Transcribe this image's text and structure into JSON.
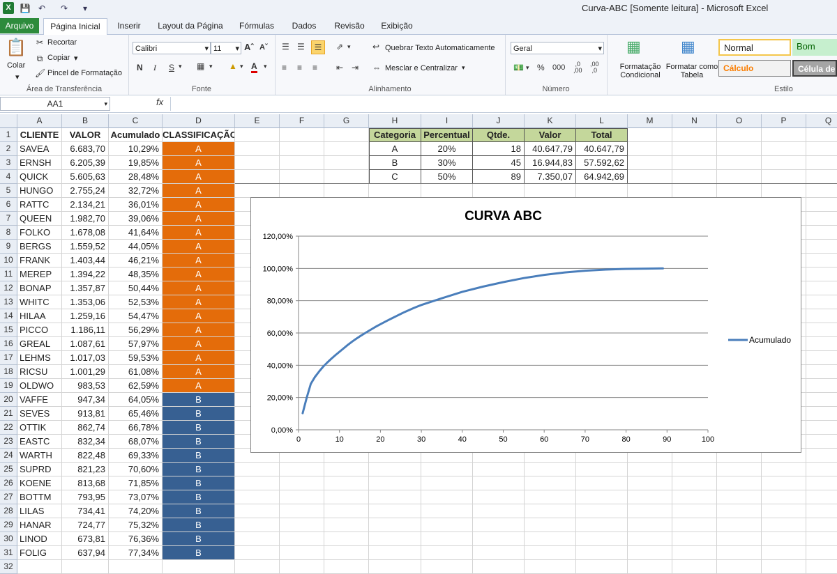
{
  "window": {
    "app_logo": "excel-icon",
    "title": "Curva-ABC  [Somente leitura]  -  Microsoft Excel"
  },
  "qat": {
    "save_icon": "save-icon",
    "undo_icon": "undo-icon",
    "redo_icon": "redo-icon"
  },
  "tabs": {
    "file": "Arquivo",
    "items": [
      "Página Inicial",
      "Inserir",
      "Layout da Página",
      "Fórmulas",
      "Dados",
      "Revisão",
      "Exibição"
    ]
  },
  "ribbon": {
    "clipboard": {
      "paste": "Colar",
      "cut": "Recortar",
      "copy": "Copiar",
      "format_painter": "Pincel de Formatação",
      "label": "Área de Transferência"
    },
    "font": {
      "name": "Calibri",
      "size": "11",
      "bold": "N",
      "italic": "I",
      "underline": "S",
      "label": "Fonte"
    },
    "alignment": {
      "wrap": "Quebrar Texto Automaticamente",
      "merge": "Mesclar e Centralizar",
      "label": "Alinhamento"
    },
    "number": {
      "format": "Geral",
      "percent": "%",
      "thousands": "000",
      "label": "Número"
    },
    "styles": {
      "conditional": "Formatação Condicional",
      "as_table": "Formatar como Tabela",
      "normal": "Normal",
      "good": "Bom",
      "calc": "Cálculo",
      "check_cell": "Célula de",
      "label": "Estilo"
    }
  },
  "formula_bar": {
    "name_box": "AA1",
    "fx": "fx",
    "formula": ""
  },
  "columns": [
    "A",
    "B",
    "C",
    "D",
    "E",
    "F",
    "G",
    "H",
    "I",
    "J",
    "K",
    "L",
    "M",
    "N",
    "O",
    "P",
    "Q"
  ],
  "sheet": {
    "headers": [
      "CLIENTE",
      "VALOR",
      "Acumulado",
      "CLASSIFICAÇÃO"
    ],
    "rows": [
      [
        "SAVEA",
        "6.683,70",
        "10,29%",
        "A"
      ],
      [
        "ERNSH",
        "6.205,39",
        "19,85%",
        "A"
      ],
      [
        "QUICK",
        "5.605,63",
        "28,48%",
        "A"
      ],
      [
        "HUNGO",
        "2.755,24",
        "32,72%",
        "A"
      ],
      [
        "RATTC",
        "2.134,21",
        "36,01%",
        "A"
      ],
      [
        "QUEEN",
        "1.982,70",
        "39,06%",
        "A"
      ],
      [
        "FOLKO",
        "1.678,08",
        "41,64%",
        "A"
      ],
      [
        "BERGS",
        "1.559,52",
        "44,05%",
        "A"
      ],
      [
        "FRANK",
        "1.403,44",
        "46,21%",
        "A"
      ],
      [
        "MEREP",
        "1.394,22",
        "48,35%",
        "A"
      ],
      [
        "BONAP",
        "1.357,87",
        "50,44%",
        "A"
      ],
      [
        "WHITC",
        "1.353,06",
        "52,53%",
        "A"
      ],
      [
        "HILAA",
        "1.259,16",
        "54,47%",
        "A"
      ],
      [
        "PICCO",
        "1.186,11",
        "56,29%",
        "A"
      ],
      [
        "GREAL",
        "1.087,61",
        "57,97%",
        "A"
      ],
      [
        "LEHMS",
        "1.017,03",
        "59,53%",
        "A"
      ],
      [
        "RICSU",
        "1.001,29",
        "61,08%",
        "A"
      ],
      [
        "OLDWO",
        "983,53",
        "62,59%",
        "A"
      ],
      [
        "VAFFE",
        "947,34",
        "64,05%",
        "B"
      ],
      [
        "SEVES",
        "913,81",
        "65,46%",
        "B"
      ],
      [
        "OTTIK",
        "862,74",
        "66,78%",
        "B"
      ],
      [
        "EASTC",
        "832,34",
        "68,07%",
        "B"
      ],
      [
        "WARTH",
        "822,48",
        "69,33%",
        "B"
      ],
      [
        "SUPRD",
        "821,23",
        "70,60%",
        "B"
      ],
      [
        "KOENE",
        "813,68",
        "71,85%",
        "B"
      ],
      [
        "BOTTM",
        "793,95",
        "73,07%",
        "B"
      ],
      [
        "LILAS",
        "734,41",
        "74,20%",
        "B"
      ],
      [
        "HANAR",
        "724,77",
        "75,32%",
        "B"
      ],
      [
        "LINOD",
        "673,81",
        "76,36%",
        "B"
      ],
      [
        "FOLIG",
        "637,94",
        "77,34%",
        "B"
      ]
    ]
  },
  "summary": {
    "headers": [
      "Categoria",
      "Percentual",
      "Qtde.",
      "Valor",
      "Total"
    ],
    "rows": [
      [
        "A",
        "20%",
        "18",
        "40.647,79",
        "40.647,79"
      ],
      [
        "B",
        "30%",
        "45",
        "16.944,83",
        "57.592,62"
      ],
      [
        "C",
        "50%",
        "89",
        "7.350,07",
        "64.942,69"
      ]
    ]
  },
  "colors": {
    "class_a": "#e46c0a",
    "class_b": "#376092",
    "summary_header": "#c4d79b",
    "series": "#4a7ebb"
  },
  "chart_data": {
    "type": "line",
    "title": "CURVA ABC",
    "xlabel": "",
    "ylabel": "",
    "xlim": [
      0,
      100
    ],
    "ylim": [
      0,
      120
    ],
    "x_ticks": [
      "0",
      "10",
      "20",
      "30",
      "40",
      "50",
      "60",
      "70",
      "80",
      "90",
      "100"
    ],
    "y_ticks": [
      "0,00%",
      "20,00%",
      "40,00%",
      "60,00%",
      "80,00%",
      "100,00%",
      "120,00%"
    ],
    "legend_position": "right",
    "series": [
      {
        "name": "Acumulado",
        "x": [
          1,
          2,
          3,
          4,
          5,
          6,
          7,
          8,
          9,
          10,
          11,
          12,
          13,
          14,
          15,
          16,
          17,
          18,
          19,
          20,
          21,
          22,
          23,
          24,
          25,
          26,
          27,
          28,
          29,
          30,
          35,
          40,
          45,
          50,
          55,
          60,
          65,
          70,
          75,
          80,
          85,
          89
        ],
        "y": [
          10.29,
          19.85,
          28.48,
          32.72,
          36.01,
          39.06,
          41.64,
          44.05,
          46.21,
          48.35,
          50.44,
          52.53,
          54.47,
          56.29,
          57.97,
          59.53,
          61.08,
          62.59,
          64.05,
          65.46,
          66.78,
          68.07,
          69.33,
          70.6,
          71.85,
          73.07,
          74.2,
          75.32,
          76.36,
          77.34,
          81.5,
          85.5,
          88.7,
          91.5,
          94.0,
          96.0,
          97.5,
          98.6,
          99.3,
          99.7,
          99.9,
          100
        ]
      }
    ],
    "grid": "horizontal"
  }
}
